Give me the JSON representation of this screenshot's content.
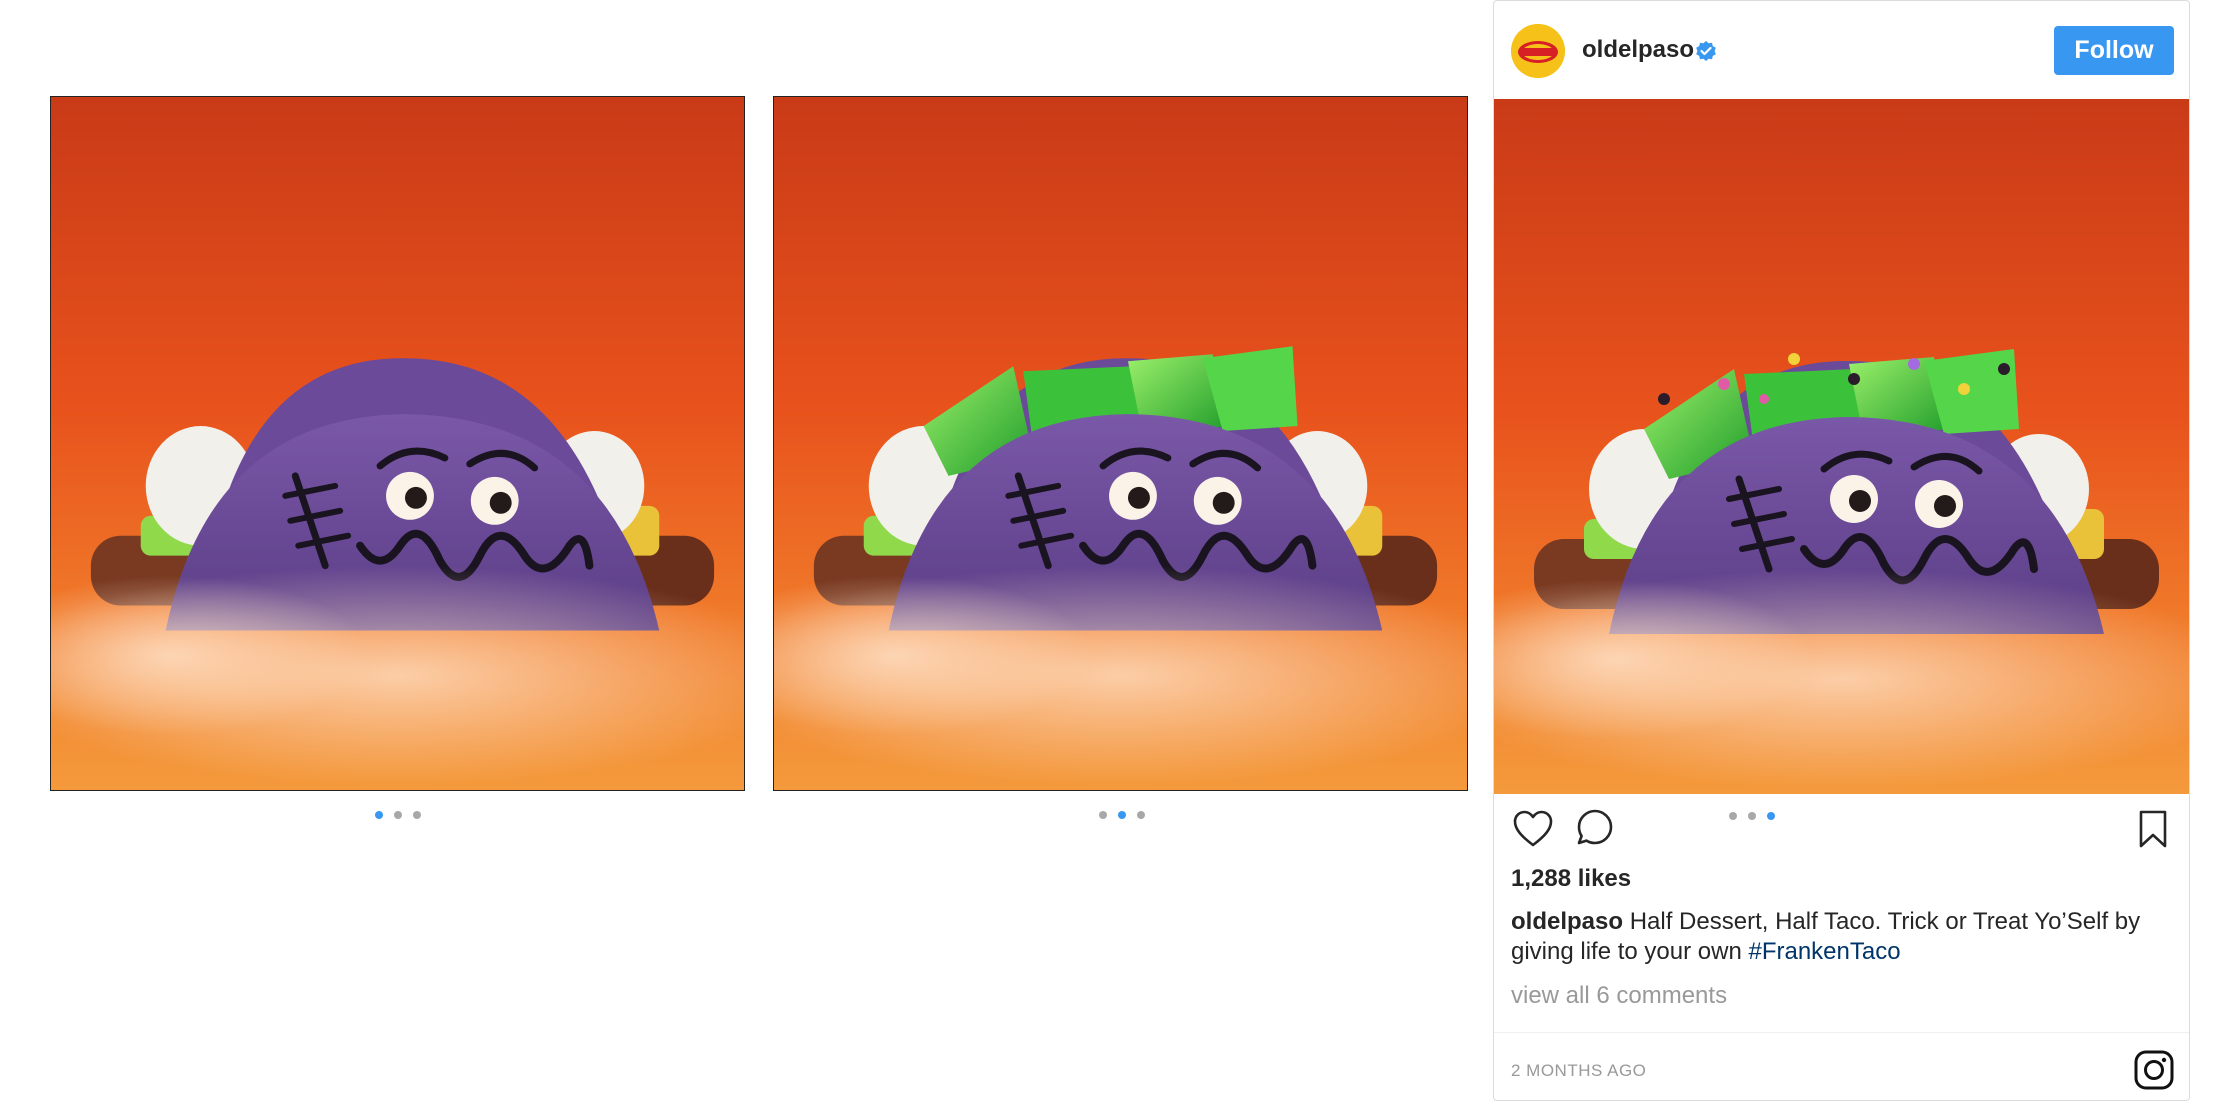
{
  "post": {
    "username": "oldelpaso",
    "follow_label": "Follow",
    "likes": "1,288 likes",
    "caption_user": "oldelpaso",
    "caption_text": " Half Dessert, Half Taco. Trick or Treat Yo’Self by giving life to your own ",
    "hashtag": "#FrankenTaco",
    "view_comments": "view all 6 comments",
    "timestamp": "2 MONTHS AGO",
    "avatar_logo_text": "Old El Paso"
  },
  "carousel": {
    "total_slides": 3,
    "slide_1_active_index": 0,
    "slide_2_active_index": 1,
    "card_active_index": 2
  },
  "icons": {
    "like": "heart-icon",
    "comment": "comment-icon",
    "save": "bookmark-icon",
    "verified": "verified-badge-icon",
    "brand": "instagram-icon"
  },
  "colors": {
    "accent_blue": "#3897f0",
    "hashtag_blue": "#003569",
    "muted_gray": "#999999",
    "background_orange": "#e8521c",
    "taco_purple": "#6e4c9a",
    "jelly_green": "#3cc23a"
  }
}
